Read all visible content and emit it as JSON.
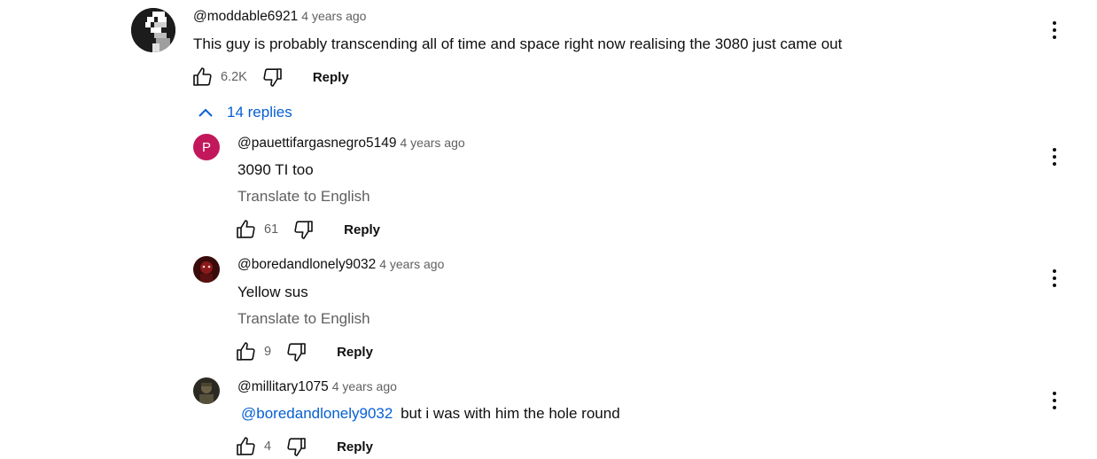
{
  "comments": [
    {
      "handle": "@moddable6921",
      "time": "4 years ago",
      "text": "This guy is probably transcending all of time and space right now realising the 3080 just came out",
      "likes": "6.2K",
      "reply_label": "Reply"
    }
  ],
  "replies_toggle": {
    "label": "14 replies"
  },
  "replies": [
    {
      "avatar_letter": "P",
      "avatar_color": "#c2185b",
      "handle": "@pauettifargasnegro5149",
      "time": "4 years ago",
      "text": "3090 TI too",
      "translate": "Translate to English",
      "likes": "61",
      "reply_label": "Reply"
    },
    {
      "handle": "@boredandlonely9032",
      "time": "4 years ago",
      "text": "Yellow sus",
      "translate": "Translate to English",
      "likes": "9",
      "reply_label": "Reply"
    },
    {
      "handle": "@millitary1075",
      "time": "4 years ago",
      "mention": "@boredandlonely9032",
      "text": "but i was with him the hole round",
      "likes": "4",
      "reply_label": "Reply"
    }
  ]
}
